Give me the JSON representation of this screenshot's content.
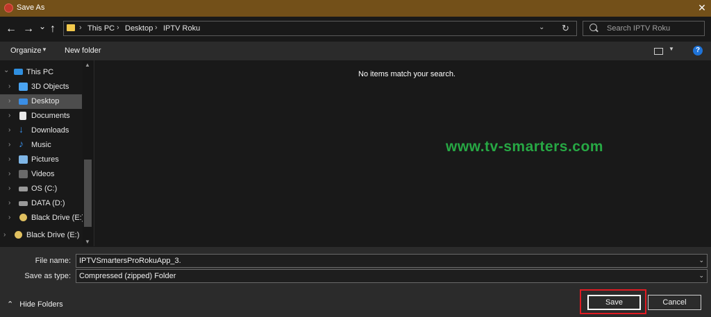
{
  "window": {
    "title": "Save As",
    "close_glyph": "✕"
  },
  "nav": {
    "back_glyph": "←",
    "forward_glyph": "→",
    "recent_glyph": "⌄",
    "up_glyph": "↑",
    "breadcrumbs": [
      "This PC",
      "Desktop",
      "IPTV Roku"
    ],
    "separator": "›",
    "dropdown_glyph": "⌄",
    "refresh_glyph": "↻",
    "search_placeholder": "Search IPTV Roku"
  },
  "toolbar": {
    "organize_label": "Organize",
    "organize_dd": "▼",
    "new_folder_label": "New folder",
    "view_dd": "▼",
    "help_glyph": "?"
  },
  "tree": {
    "items": [
      {
        "label": "This PC",
        "expanded": true,
        "icon": "pc-icon"
      },
      {
        "label": "3D Objects",
        "icon": "cube-icon"
      },
      {
        "label": "Desktop",
        "icon": "desktop-icon",
        "selected": true
      },
      {
        "label": "Documents",
        "icon": "document-icon"
      },
      {
        "label": "Downloads",
        "icon": "download-icon"
      },
      {
        "label": "Music",
        "icon": "music-icon"
      },
      {
        "label": "Pictures",
        "icon": "pictures-icon"
      },
      {
        "label": "Videos",
        "icon": "video-icon"
      },
      {
        "label": "OS (C:)",
        "icon": "drive-icon"
      },
      {
        "label": "DATA (D:)",
        "icon": "drive-icon"
      },
      {
        "label": "Black Drive (E:)",
        "icon": "cd-drive-icon"
      }
    ],
    "extra": {
      "label": "Black Drive (E:)",
      "icon": "cd-drive-icon"
    },
    "chevron_collapsed": "›",
    "chevron_expanded": "⌄",
    "scroll_up": "▲",
    "scroll_down": "▼"
  },
  "content": {
    "empty_message": "No items match your search.",
    "watermark": "www.tv-smarters.com"
  },
  "form": {
    "file_name_label": "File name:",
    "file_name_value": "IPTVSmartersProRokuApp_3.",
    "save_type_label": "Save as type:",
    "save_type_value": "Compressed (zipped) Folder",
    "dropdown_glyph": "⌄"
  },
  "footer": {
    "hide_folders_glyph": "⌃",
    "hide_folders_label": "Hide Folders",
    "save_label": "Save",
    "cancel_label": "Cancel"
  },
  "colors": {
    "titlebar": "#735019",
    "highlight": "#e01b22",
    "watermark": "#27a844",
    "help": "#1e73d8"
  }
}
